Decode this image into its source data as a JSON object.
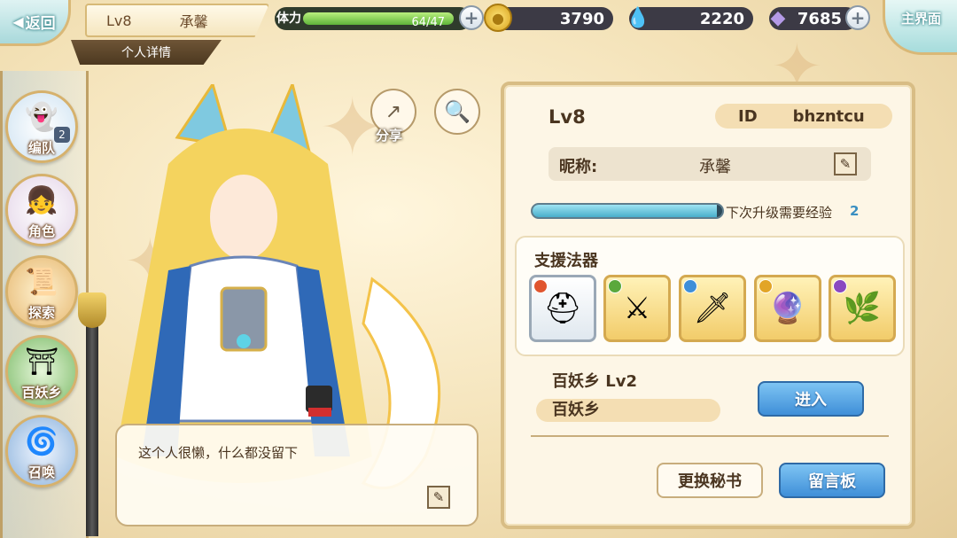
{
  "top_bar": {
    "back_label": "返回",
    "level": "Lv8",
    "username": "承馨",
    "detail_tab": "个人详情",
    "stamina_label": "体力",
    "stamina_value": "64/47",
    "stamina_fraction": 1.0,
    "gold": "3790",
    "gems": "2220",
    "crystals": "7685",
    "home_label": "主界面"
  },
  "nav": {
    "items": [
      {
        "label": "编队",
        "icon": "team-icon",
        "badge": "2"
      },
      {
        "label": "角色",
        "icon": "character-icon"
      },
      {
        "label": "探索",
        "icon": "explore-icon"
      },
      {
        "label": "百妖乡",
        "icon": "village-icon"
      },
      {
        "label": "召唤",
        "icon": "summon-icon"
      }
    ]
  },
  "character": {
    "share_label": "分享",
    "bio": "这个人很懒，什么都没留下"
  },
  "panel": {
    "level": "Lv8",
    "id_label": "ID",
    "id_value": "bhzntcu",
    "nickname_label": "昵称:",
    "nickname_value": "承馨",
    "exp_label": "下次升级需要经验",
    "exp_value": "2",
    "exp_fraction": 0.97,
    "artifacts_title": "支援法器",
    "artifacts": [
      {
        "name": "artifact-helmet-icon",
        "glyph": "⛑",
        "element_color": "#e0552f"
      },
      {
        "name": "artifact-crossbow-icon",
        "glyph": "⚔",
        "element_color": "#5aa83c"
      },
      {
        "name": "artifact-blade-icon",
        "glyph": "🗡",
        "element_color": "#3f8fd8"
      },
      {
        "name": "artifact-orb-icon",
        "glyph": "🔮",
        "element_color": "#e2a526"
      },
      {
        "name": "artifact-pot-icon",
        "glyph": "🌿",
        "element_color": "#8a48c0"
      }
    ],
    "village_label": "百妖乡  Lv2",
    "village_name": "百妖乡",
    "enter_label": "进入",
    "change_secretary_label": "更换秘书",
    "message_board_label": "留言板"
  }
}
